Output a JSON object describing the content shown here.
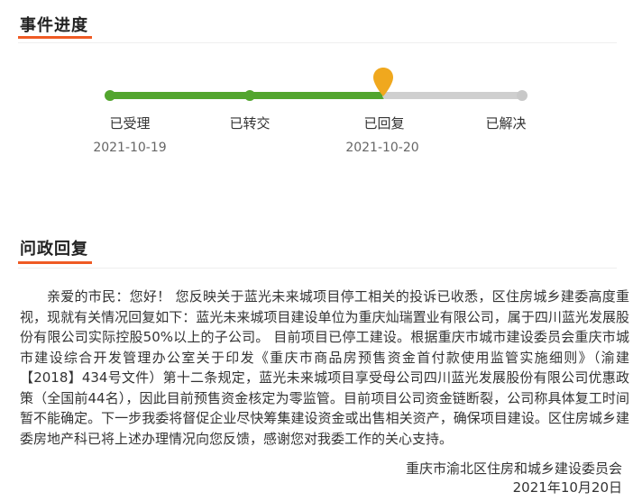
{
  "progress": {
    "title": "事件进度",
    "steps": [
      {
        "label": "已受理",
        "date": "2021-10-19",
        "state": "done"
      },
      {
        "label": "已转交",
        "date": "",
        "state": "done"
      },
      {
        "label": "已回复",
        "date": "2021-10-20",
        "state": "current"
      },
      {
        "label": "已解决",
        "date": "",
        "state": "pending"
      }
    ]
  },
  "reply": {
    "title": "问政回复",
    "body": "亲爱的市民：您好！ 您反映关于蓝光未来城项目停工相关的投诉已收悉，区住房城乡建委高度重视，现就有关情况回复如下：蓝光未来城项目建设单位为重庆灿瑞置业有限公司，属于四川蓝光发展股份有限公司实际控股50%以上的子公司。 目前项目已停工建设。根据重庆市城市建设委员会重庆市城市建设综合开发管理办公室关于印发《重庆市商品房预售资金首付款使用监管实施细则》（渝建【2018】434号文件）第十二条规定，蓝光未来城项目享受母公司四川蓝光发展股份有限公司优惠政策（全国前44名），因此目前预售资金核定为零监管。目前项目公司资金链断裂，公司称具体复工时间暂不能确定。下一步我委将督促企业尽快筹集建设资金或出售相关资产，确保项目建设。区住房城乡建委房地产科已将上述办理情况向您反馈，感谢您对我委工作的关心支持。",
    "signature": "重庆市渝北区住房和城乡建设委员会",
    "sign_date": "2021年10月20日"
  },
  "colors": {
    "accent": "#ef5a24",
    "done": "#52a52e",
    "pending": "#cfcfcf",
    "marker": "#f0a81e"
  }
}
